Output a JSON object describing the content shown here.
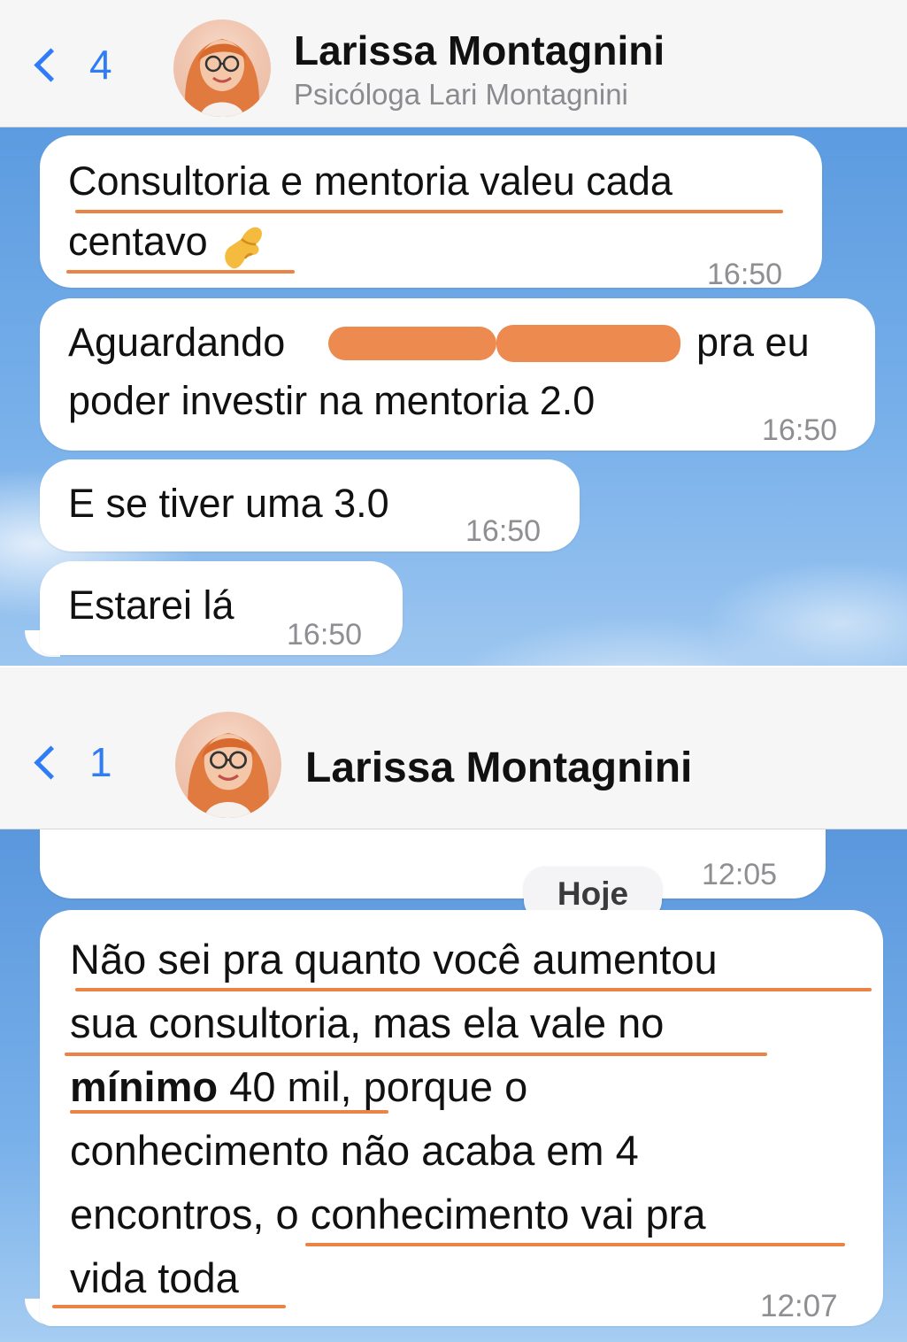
{
  "screen1": {
    "back_count": "4",
    "contact_name": "Larissa Montagnini",
    "contact_subtitle": "Psicóloga Lari Montagnini",
    "messages": [
      {
        "line1": "Consultoria e mentoria valeu cada",
        "line2": "centavo",
        "emoji": "pinched-fingers-icon",
        "time": "16:50"
      },
      {
        "line1_start": "Aguardando",
        "line1_end": "pra eu",
        "line2": "poder investir na mentoria 2.0",
        "time": "16:50"
      },
      {
        "text": "E se tiver uma 3.0",
        "time": "16:50"
      },
      {
        "text": "Estarei lá",
        "time": "16:50"
      }
    ]
  },
  "screen2": {
    "back_count": "1",
    "contact_name": "Larissa Montagnini",
    "prev_time": "12:05",
    "date_chip": "Hoje",
    "message": {
      "line1": "Não sei pra quanto você aumentou",
      "line2": "sua consultoria, mas ela vale no",
      "line3_bold": "mínimo",
      "line3_rest": " 40 mil, porque o",
      "line4": "conhecimento não acaba em 4",
      "line5": "encontros, o conhecimento vai pra",
      "line6": "vida toda",
      "time": "12:07"
    }
  },
  "colors": {
    "accent_blue": "#2f7cf6",
    "underline_orange": "#ea8346",
    "bubble_white": "#ffffff"
  }
}
